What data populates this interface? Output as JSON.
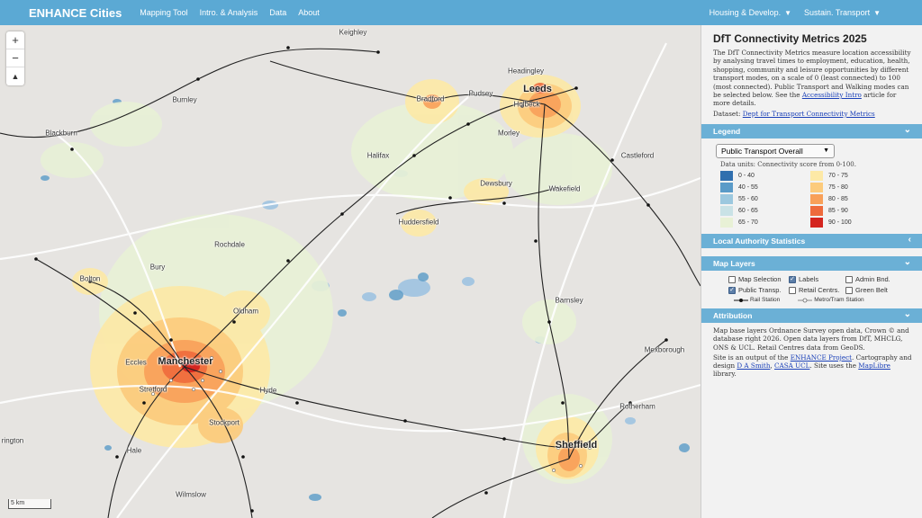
{
  "nav": {
    "brand": "ENHANCE Cities",
    "links": [
      "Mapping Tool",
      "Intro. & Analysis",
      "Data",
      "About"
    ],
    "dropdowns": [
      "Housing & Develop.",
      "Sustain. Transport"
    ]
  },
  "map": {
    "zoom_in": "+",
    "zoom_out": "−",
    "compass": "▲",
    "scale": "5 km",
    "places": [
      {
        "name": "Keighley",
        "big": false
      },
      {
        "name": "Headingley",
        "big": false
      },
      {
        "name": "Leeds",
        "big": true
      },
      {
        "name": "Bradford",
        "big": false
      },
      {
        "name": "Pudsey",
        "big": false
      },
      {
        "name": "Holbeck",
        "big": false
      },
      {
        "name": "Burnley",
        "big": false
      },
      {
        "name": "Blackburn",
        "big": false
      },
      {
        "name": "Morley",
        "big": false
      },
      {
        "name": "Halifax",
        "big": false
      },
      {
        "name": "Castleford",
        "big": false
      },
      {
        "name": "Dewsbury",
        "big": false
      },
      {
        "name": "Wakefield",
        "big": false
      },
      {
        "name": "Huddersfield",
        "big": false
      },
      {
        "name": "Rochdale",
        "big": false
      },
      {
        "name": "Bury",
        "big": false
      },
      {
        "name": "Bolton",
        "big": false
      },
      {
        "name": "Oldham",
        "big": false
      },
      {
        "name": "Barnsley",
        "big": false
      },
      {
        "name": "Manchester",
        "big": true
      },
      {
        "name": "Eccles",
        "big": false
      },
      {
        "name": "Stretford",
        "big": false
      },
      {
        "name": "Hyde",
        "big": false
      },
      {
        "name": "Stockport",
        "big": false
      },
      {
        "name": "Mexborough",
        "big": false
      },
      {
        "name": "Rotherham",
        "big": false
      },
      {
        "name": "Sheffield",
        "big": true
      },
      {
        "name": "Hale",
        "big": false
      },
      {
        "name": "Wilmslow",
        "big": false
      },
      {
        "name": "rington",
        "big": false
      }
    ]
  },
  "sidebar": {
    "title": "DfT Connectivity Metrics 2025",
    "intro": "The DfT Connectivity Metrics measure location accessibility by analysing travel times to employment, education, health, shopping, community and leisure opportunities by different transport modes, on a scale of 0 (least connected) to 100 (most connected). Public Transport and Walking modes can be selected below. See the",
    "intro_link": "Accessibility Intro",
    "intro_tail": "article for more details.",
    "dataset_label": "Dataset:",
    "dataset_link": "Dept for Transport Connectivity Metrics",
    "legend_head": "Legend",
    "select_value": "Public Transport Overall",
    "units": "Data units: Connectivity score from 0-100.",
    "legend_items": [
      {
        "label": "0 - 40",
        "color": "#2f6fae"
      },
      {
        "label": "40 - 55",
        "color": "#5a9bc8"
      },
      {
        "label": "55 - 60",
        "color": "#9cc8df"
      },
      {
        "label": "60 - 65",
        "color": "#c9e2e6"
      },
      {
        "label": "65 - 70",
        "color": "#e8f1d6"
      },
      {
        "label": "70 - 75",
        "color": "#fde9a6"
      },
      {
        "label": "75 - 80",
        "color": "#fccb7c"
      },
      {
        "label": "80 - 85",
        "color": "#f8a059"
      },
      {
        "label": "85 - 90",
        "color": "#ee6a3c"
      },
      {
        "label": "90 - 100",
        "color": "#d4251f"
      }
    ],
    "stats_head": "Local Authority Statistics",
    "layers_head": "Map Layers",
    "layers": [
      {
        "label": "Map Selection",
        "checked": false
      },
      {
        "label": "Labels",
        "checked": true
      },
      {
        "label": "Admin Bnd.",
        "checked": false
      },
      {
        "label": "Public Transp.",
        "checked": true
      },
      {
        "label": "Retail Centrs.",
        "checked": false
      },
      {
        "label": "Green Belt",
        "checked": false
      }
    ],
    "rail_station": "Rail Station",
    "metro_station": "Metro/Tram Station",
    "attr_head": "Attribution",
    "attr_p1": "Map base layers Ordnance Survey open data, Crown © and database right 2026. Open data layers from DfT, MHCLG, ONS & UCL. Retail Centres data from GeoDS.",
    "attr_p2_a": "Site is an output of the",
    "attr_link1": "ENHANCE Project",
    "attr_p2_b": ". Cartography and design",
    "attr_link2": "D A Smith",
    "attr_link3": "CASA UCL",
    "attr_p2_c": ". Site uses the",
    "attr_link4": "MapLibre",
    "attr_p2_d": "library."
  }
}
